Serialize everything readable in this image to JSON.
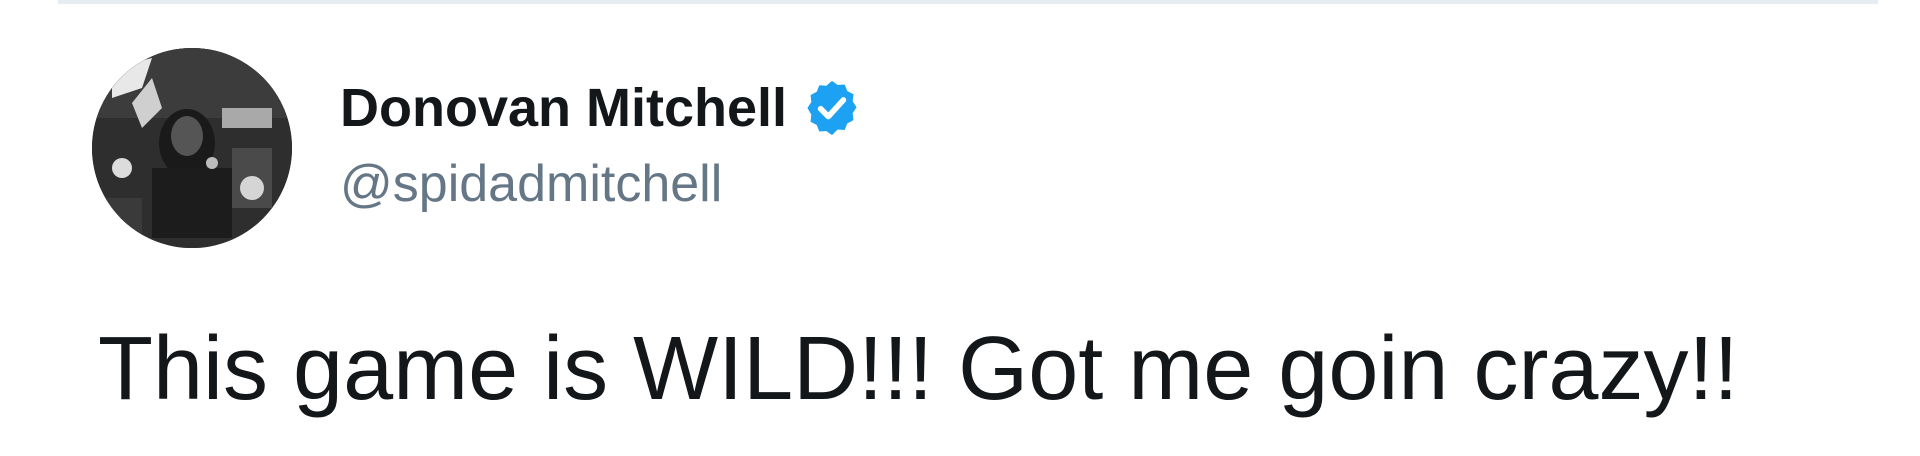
{
  "tweet": {
    "author": {
      "display_name": "Donovan Mitchell",
      "handle": "@spidadmitchell",
      "verified": true,
      "verified_icon": "verified-badge-icon",
      "avatar": "profile-photo"
    },
    "text": "This game is WILD!!! Got me goin crazy!!"
  },
  "colors": {
    "text_primary": "#14171a",
    "text_secondary": "#657786",
    "verified_blue": "#1da1f2",
    "divider": "#e6ecf0"
  }
}
